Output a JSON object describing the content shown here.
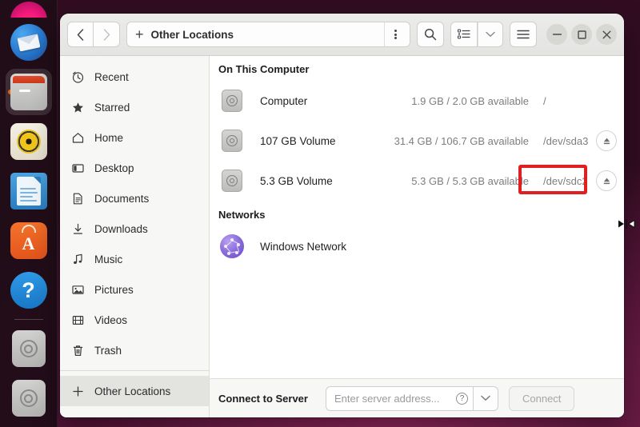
{
  "window": {
    "path_label": "Other Locations",
    "add_icon": "plus-icon",
    "back_icon": "chevron-left-icon",
    "forward_icon": "chevron-right-icon",
    "menu_icon": "kebab-menu-icon",
    "search_icon": "search-icon",
    "list_view_icon": "list-view-icon",
    "view_dropdown_icon": "chevron-down-icon",
    "hamburger_icon": "hamburger-menu-icon",
    "minimize_icon": "minimize-icon",
    "maximize_icon": "maximize-icon",
    "close_icon": "close-icon"
  },
  "sidebar": {
    "items": [
      {
        "label": "Recent",
        "icon": "clock-icon",
        "selected": false
      },
      {
        "label": "Starred",
        "icon": "star-icon",
        "selected": false
      },
      {
        "label": "Home",
        "icon": "home-icon",
        "selected": false
      },
      {
        "label": "Desktop",
        "icon": "desktop-icon",
        "selected": false
      },
      {
        "label": "Documents",
        "icon": "document-icon",
        "selected": false
      },
      {
        "label": "Downloads",
        "icon": "download-icon",
        "selected": false
      },
      {
        "label": "Music",
        "icon": "music-note-icon",
        "selected": false
      },
      {
        "label": "Pictures",
        "icon": "picture-icon",
        "selected": false
      },
      {
        "label": "Videos",
        "icon": "video-icon",
        "selected": false
      },
      {
        "label": "Trash",
        "icon": "trash-icon",
        "selected": false
      },
      {
        "label": "Other Locations",
        "icon": "plus-icon",
        "selected": true
      }
    ]
  },
  "content": {
    "sections": [
      {
        "heading": "On This Computer",
        "rows": [
          {
            "name": "Computer",
            "available": "1.9 GB / 2.0 GB available",
            "device": "/",
            "eject": false,
            "icon": "drive-icon",
            "highlighted": false
          },
          {
            "name": "107 GB Volume",
            "available": "31.4 GB / 106.7 GB available",
            "device": "/dev/sda3",
            "eject": true,
            "icon": "drive-icon",
            "highlighted": false
          },
          {
            "name": "5.3 GB Volume",
            "available": "5.3 GB / 5.3 GB available",
            "device": "/dev/sdc2",
            "eject": true,
            "icon": "drive-icon",
            "highlighted": true
          }
        ]
      },
      {
        "heading": "Networks",
        "rows": [
          {
            "name": "Windows Network",
            "available": "",
            "device": "",
            "eject": false,
            "icon": "network-globe-icon",
            "highlighted": false
          }
        ]
      }
    ]
  },
  "connect_bar": {
    "label": "Connect to Server",
    "input_value": "",
    "input_placeholder": "Enter server address...",
    "help_icon": "question-mark-icon",
    "dropdown_icon": "chevron-down-icon",
    "button_label": "Connect"
  },
  "annotation": {
    "color": "#e02020",
    "target_text": "/dev/sdc2"
  },
  "dock": {
    "items": [
      {
        "name": "firefox",
        "label": "Firefox",
        "running": false
      },
      {
        "name": "thunderbird",
        "label": "Thunderbird Mail",
        "running": false
      },
      {
        "name": "files",
        "label": "Files",
        "running": true
      },
      {
        "name": "rhythmbox",
        "label": "Rhythmbox",
        "running": false
      },
      {
        "name": "libreoffice",
        "label": "LibreOffice Writer",
        "running": false
      },
      {
        "name": "ubuntu-software",
        "label": "Ubuntu Software",
        "running": false
      },
      {
        "name": "help",
        "label": "Help",
        "running": false
      },
      {
        "name": "drive-1",
        "label": "Volume",
        "running": false
      },
      {
        "name": "drive-2",
        "label": "Volume",
        "running": false
      }
    ]
  }
}
